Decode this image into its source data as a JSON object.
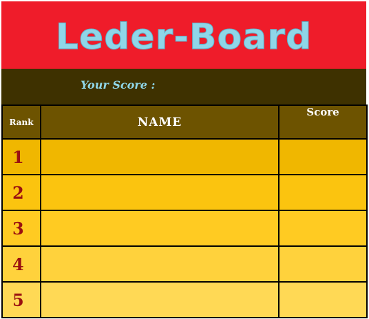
{
  "title": "Leder-Board",
  "your_score": {
    "label": "Your Score :",
    "value": ""
  },
  "table": {
    "headers": {
      "rank": "Rank",
      "name": "NAME",
      "score": "Score"
    },
    "rows": [
      {
        "rank": "1",
        "name": "",
        "score": ""
      },
      {
        "rank": "2",
        "name": "",
        "score": ""
      },
      {
        "rank": "3",
        "name": "",
        "score": ""
      },
      {
        "rank": "4",
        "name": "",
        "score": ""
      },
      {
        "rank": "5",
        "name": "",
        "score": ""
      }
    ]
  },
  "colors": {
    "title_bar": "#ef1c2a",
    "title_text": "#8fd6e8",
    "score_bar": "#3e3100",
    "header_row": "#6d5300",
    "rank_number": "#9a1010",
    "row_fills": [
      "#f0b700",
      "#fbc40f",
      "#ffcb22",
      "#ffd23c",
      "#ffd955"
    ]
  }
}
